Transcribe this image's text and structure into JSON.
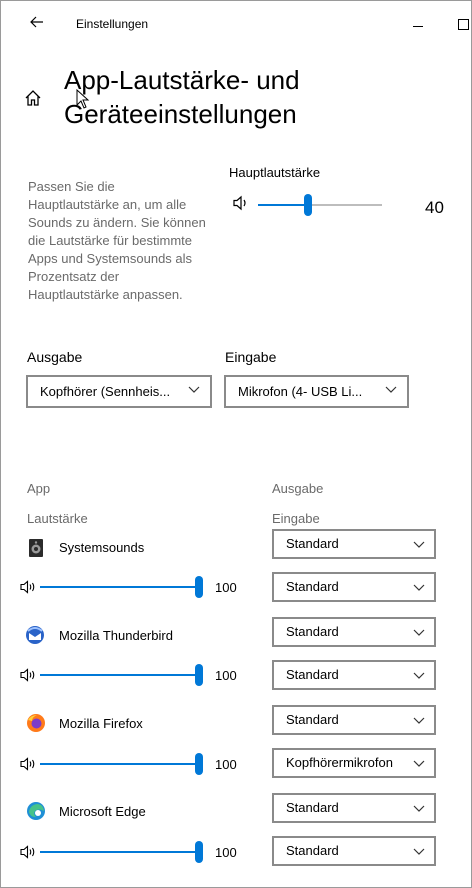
{
  "window": {
    "title": "Einstellungen"
  },
  "page": {
    "title": "App-Lautstärke- und Geräteeinstellungen"
  },
  "description": "Passen Sie die Hauptlautstärke an, um alle Sounds zu ändern. Sie können die Lautstärke für bestimmte Apps und Systemsounds als Prozentsatz der Hauptlautstärke anpassen.",
  "master": {
    "label": "Hauptlautstärke",
    "value": "40",
    "level": 0.4
  },
  "output": {
    "label": "Ausgabe",
    "selected": "Kopfhörer (Sennheis..."
  },
  "input": {
    "label": "Eingabe",
    "selected": "Mikrofon (4- USB Li..."
  },
  "columns": {
    "app": "App",
    "volume": "Lautstärke",
    "output": "Ausgabe",
    "input": "Eingabe"
  },
  "apps": [
    {
      "name": "Systemsounds",
      "icon": "system-sounds-icon",
      "volume": "100",
      "level": 1.0,
      "output": "Standard",
      "input": "Standard"
    },
    {
      "name": "Mozilla Thunderbird",
      "icon": "thunderbird-icon",
      "volume": "100",
      "level": 1.0,
      "output": "Standard",
      "input": "Standard"
    },
    {
      "name": "Mozilla Firefox",
      "icon": "firefox-icon",
      "volume": "100",
      "level": 1.0,
      "output": "Standard",
      "input": "Kopfhörermikrofon"
    },
    {
      "name": "Microsoft Edge",
      "icon": "edge-icon",
      "volume": "100",
      "level": 1.0,
      "output": "Standard",
      "input": "Standard"
    }
  ],
  "colors": {
    "accent": "#0078d7",
    "muted_text": "#6a6a6a",
    "border": "#8a8a8a"
  }
}
